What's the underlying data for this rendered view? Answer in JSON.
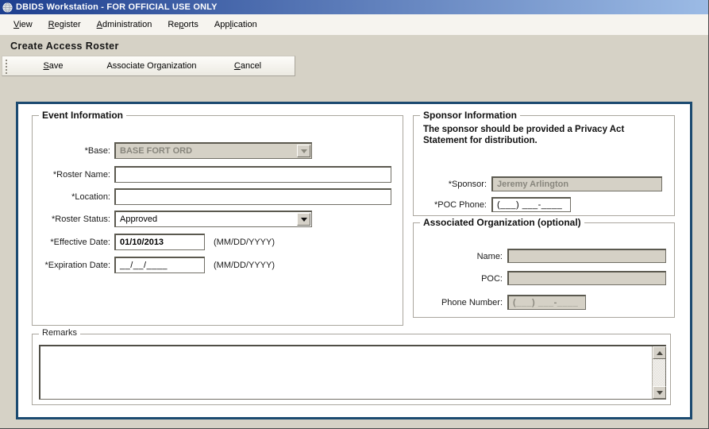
{
  "window": {
    "title": "DBIDS Workstation - FOR OFFICIAL USE ONLY",
    "icon": "globe-icon"
  },
  "menu": {
    "items": [
      {
        "name": "view",
        "pre": "",
        "accel": "V",
        "post": "iew"
      },
      {
        "name": "register",
        "pre": "",
        "accel": "R",
        "post": "egister"
      },
      {
        "name": "administration",
        "pre": "",
        "accel": "A",
        "post": "dministration"
      },
      {
        "name": "reports",
        "pre": "Re",
        "accel": "p",
        "post": "orts"
      },
      {
        "name": "application",
        "pre": "App",
        "accel": "l",
        "post": "ication"
      }
    ]
  },
  "page": {
    "title": "Create Access Roster"
  },
  "toolbar": {
    "save": {
      "pre": "",
      "accel": "S",
      "post": "ave"
    },
    "assoc": {
      "pre": "Associate Organization",
      "accel": "",
      "post": ""
    },
    "cancel": {
      "pre": "",
      "accel": "C",
      "post": "ancel"
    }
  },
  "event_info": {
    "title": "Event Information",
    "base_label": "*Base:",
    "base_value": "BASE FORT ORD",
    "roster_name_label": "*Roster Name:",
    "roster_name_value": "",
    "location_label": "*Location:",
    "location_value": "",
    "roster_status_label": "*Roster Status:",
    "roster_status_value": "Approved",
    "effective_date_label": "*Effective Date:",
    "effective_date_value": "01/10/2013",
    "effective_date_hint": "(MM/DD/YYYY)",
    "expiration_date_label": "*Expiration Date:",
    "expiration_date_value": "__/__/____",
    "expiration_date_hint": "(MM/DD/YYYY)"
  },
  "sponsor_info": {
    "title": "Sponsor Information",
    "notice": "The sponsor should be provided a Privacy Act Statement for distribution.",
    "sponsor_label": "*Sponsor:",
    "sponsor_value": "Jeremy Arlington",
    "poc_phone_label": "*POC Phone:",
    "poc_phone_value": "(___) ___-____"
  },
  "associated_org": {
    "title": "Associated Organization (optional)",
    "name_label": "Name:",
    "name_value": "",
    "poc_label": "POC:",
    "poc_value": "",
    "phone_label": "Phone Number:",
    "phone_value": "(___) ___-____"
  },
  "remarks": {
    "title": "Remarks",
    "value": ""
  },
  "icons": {
    "window_icon": "globe-icon",
    "combo_arrow": "chevron-down-icon",
    "scrollbar_up": "triangle-up-icon",
    "scrollbar_down": "triangle-down-icon",
    "toolbar_gripper": "drag-grip-icon"
  },
  "colors": {
    "titlebar_gradient_start": "#1e3f8f",
    "titlebar_gradient_end": "#9cbbe5",
    "panel_border": "#1b4a70",
    "window_bg": "#d6d2c6",
    "disabled_field_bg": "#d5d1c6",
    "disabled_text": "#88867d",
    "menubar_bg": "#f6f4ef"
  }
}
